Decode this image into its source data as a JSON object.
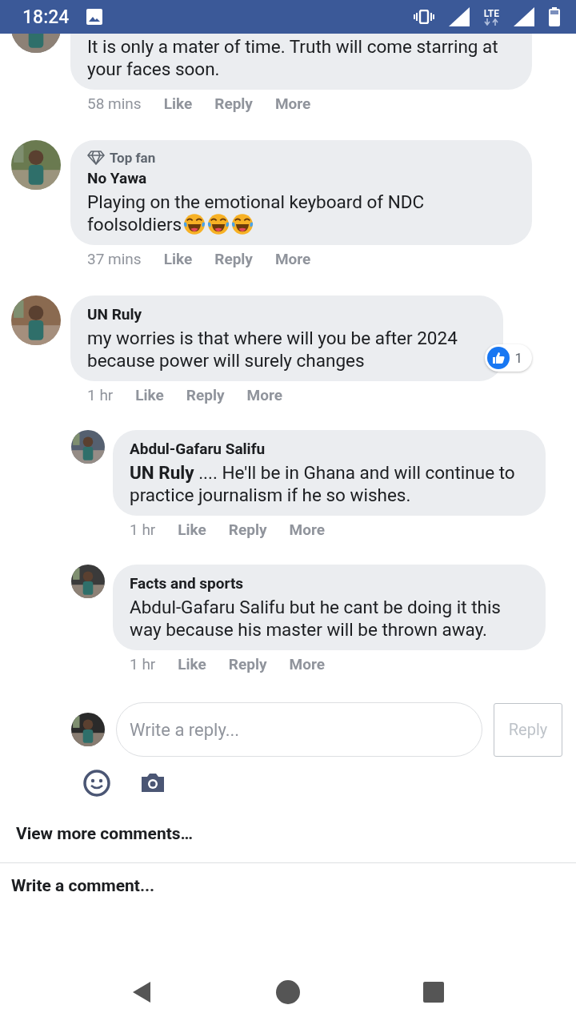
{
  "status_bar": {
    "time": "18:24",
    "network": "LTE"
  },
  "comments": [
    {
      "body": "It is only a mater of time. Truth will come starring at your faces soon.",
      "time": "58 mins",
      "actions": [
        "Like",
        "Reply",
        "More"
      ]
    },
    {
      "badge": "Top fan",
      "author": "No Yawa",
      "body": "Playing on the emotional keyboard of NDC foolsoldiers",
      "emojis": [
        {
          "kind": "laughing"
        },
        {
          "kind": "laughing"
        },
        {
          "kind": "laughing"
        }
      ],
      "time": "37 mins",
      "actions": [
        "Like",
        "Reply",
        "More"
      ]
    },
    {
      "author": "UN Ruly",
      "body": "my worries is that where will you be after 2024 because power will surely changes",
      "reaction_count": "1",
      "time": "1 hr",
      "actions": [
        "Like",
        "Reply",
        "More"
      ],
      "replies": [
        {
          "author": "Abdul-Gafaru Salifu",
          "body": "**UN Ruly** .... He'll be in Ghana and will continue to practice journalism if he so wishes.",
          "time": "1 hr",
          "actions": [
            "Like",
            "Reply",
            "More"
          ]
        },
        {
          "author": "Facts and sports",
          "body": "Abdul-Gafaru Salifu but he cant be doing it this way because his master will be thrown away.",
          "time": "1 hr",
          "actions": [
            "Like",
            "Reply",
            "More"
          ]
        }
      ],
      "reply_box": {
        "placeholder": "Write a reply...",
        "button": "Reply"
      }
    }
  ],
  "view_more": "View more comments…",
  "write_comment": "Write a comment..."
}
